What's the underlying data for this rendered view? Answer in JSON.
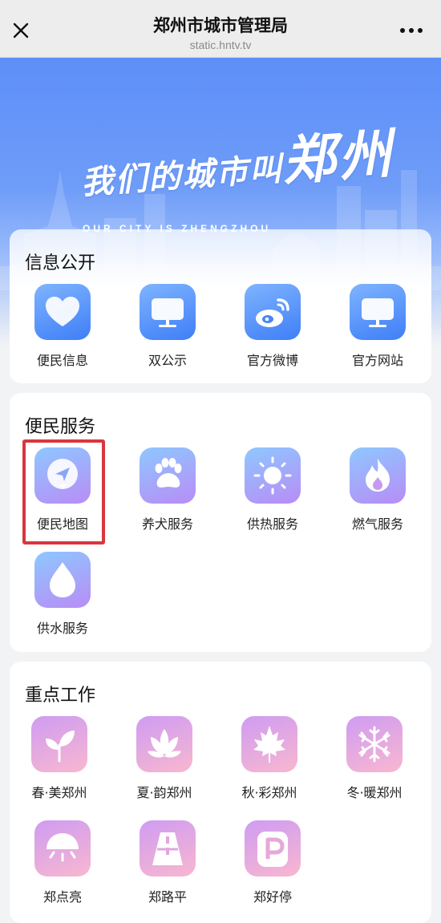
{
  "header": {
    "title": "郑州市城市管理局",
    "url": "static.hntv.tv",
    "close_icon": "close-icon",
    "more_icon": "more-dots-icon"
  },
  "banner": {
    "slogan_cn_part1": "我们的城市叫",
    "slogan_cn_part2": "郑州",
    "slogan_en": "OUR CITY   IS ZHENGZHOU",
    "colors": {
      "sky": "#5d8ff8"
    }
  },
  "sections": [
    {
      "title": "信息公开",
      "items": [
        {
          "label": "便民信息",
          "icon": "heart-icon"
        },
        {
          "label": "双公示",
          "icon": "monitor-icon"
        },
        {
          "label": "官方微博",
          "icon": "weibo-icon"
        },
        {
          "label": "官方网站",
          "icon": "monitor-icon"
        }
      ]
    },
    {
      "title": "便民服务",
      "items": [
        {
          "label": "便民地图",
          "icon": "map-pin-icon"
        },
        {
          "label": "养犬服务",
          "icon": "paw-icon"
        },
        {
          "label": "供热服务",
          "icon": "sun-icon"
        },
        {
          "label": "燃气服务",
          "icon": "flame-icon"
        },
        {
          "label": "供水服务",
          "icon": "water-drop-icon"
        }
      ]
    },
    {
      "title": "重点工作",
      "items": [
        {
          "label": "春·美郑州",
          "icon": "sprout-icon"
        },
        {
          "label": "夏·韵郑州",
          "icon": "lotus-icon"
        },
        {
          "label": "秋·彩郑州",
          "icon": "maple-leaf-icon"
        },
        {
          "label": "冬·暖郑州",
          "icon": "snowflake-icon"
        },
        {
          "label": "郑点亮",
          "icon": "lamp-icon"
        },
        {
          "label": "郑路平",
          "icon": "road-icon"
        },
        {
          "label": "郑好停",
          "icon": "parking-icon"
        }
      ]
    }
  ],
  "highlight": {
    "target": "便民地图",
    "color": "#d9363f"
  }
}
